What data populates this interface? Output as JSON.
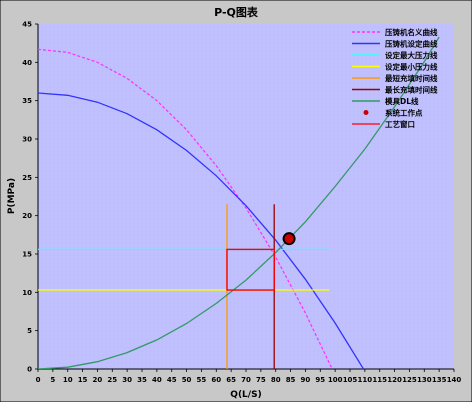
{
  "chart_data": {
    "type": "line",
    "title": "P-Q图表",
    "xlabel": "Q(L/S)",
    "ylabel": "P(MPa)",
    "xlim": [
      0,
      140
    ],
    "ylim": [
      0,
      45
    ],
    "xticks": [
      0,
      5,
      10,
      15,
      20,
      25,
      30,
      35,
      40,
      45,
      50,
      55,
      60,
      65,
      70,
      75,
      80,
      85,
      90,
      95,
      100,
      105,
      110,
      115,
      120,
      125,
      130,
      135,
      140
    ],
    "yticks": [
      0,
      5,
      10,
      15,
      20,
      25,
      30,
      35,
      40,
      45
    ],
    "grid": false,
    "legend_position": "top-right",
    "colors": {
      "outer_background": "#c8c8c8",
      "plot_background": "#c0c0ff",
      "compressor_nominal": "#ff33ff",
      "compressor_setting": "#3333ff",
      "set_max_pressure": "#33ffff",
      "set_min_pressure": "#ffff00",
      "shortest_fill_time": "#ff9900",
      "longest_fill_time": "#990000",
      "pump_dl": "#339966",
      "work_point": "#cc0000",
      "process_window": "#ff0000"
    },
    "series": [
      {
        "name": "压铸机名义曲线",
        "style": "dashed",
        "x": [
          0,
          10,
          20,
          30,
          40,
          50,
          60,
          70,
          80,
          90,
          100,
          104
        ],
        "y": [
          41.7,
          41.3,
          40.0,
          37.9,
          35.0,
          31.2,
          26.5,
          21.0,
          14.6,
          7.3,
          -0.8,
          -4.2
        ]
      },
      {
        "name": "压铸机设定曲线",
        "style": "solid",
        "x": [
          0,
          10,
          20,
          30,
          40,
          50,
          60,
          70,
          80,
          90,
          100,
          110,
          114
        ],
        "y": [
          36.0,
          35.7,
          34.8,
          33.3,
          31.2,
          28.5,
          25.2,
          21.3,
          16.8,
          11.7,
          6.0,
          -0.3,
          -2.8
        ]
      },
      {
        "name": "设定最大压力线",
        "style": "solid",
        "x": [
          0,
          98
        ],
        "y": [
          15.6,
          15.6
        ]
      },
      {
        "name": "设定最小压力线",
        "style": "solid",
        "x": [
          0,
          98
        ],
        "y": [
          10.3,
          10.3
        ]
      },
      {
        "name": "最短充填时间线",
        "style": "solid",
        "x": [
          63.6,
          63.6
        ],
        "y": [
          0,
          21.5
        ]
      },
      {
        "name": "最长充填时间线",
        "style": "solid",
        "x": [
          79.5,
          79.5
        ],
        "y": [
          0,
          21.5
        ]
      },
      {
        "name": "模具DL线",
        "style": "solid",
        "x": [
          0,
          10,
          20,
          30,
          40,
          50,
          60,
          70,
          80,
          90,
          100,
          110,
          120,
          130,
          135
        ],
        "y": [
          0,
          0.24,
          0.95,
          2.14,
          3.8,
          5.94,
          8.55,
          11.6,
          15.2,
          19.2,
          23.8,
          28.7,
          34.2,
          40.1,
          43.3
        ]
      }
    ],
    "work_point": {
      "name": "系统工作点",
      "x": 84.5,
      "y": 17.0
    },
    "process_window": {
      "name": "工艺窗口",
      "x": [
        63.6,
        79.5
      ],
      "y": [
        10.3,
        15.6
      ]
    },
    "legend": [
      {
        "label": "压铸机名义曲线",
        "kind": "dashed-line",
        "color_key": "compressor_nominal"
      },
      {
        "label": "压铸机设定曲线",
        "kind": "line",
        "color_key": "compressor_setting"
      },
      {
        "label": "设定最大压力线",
        "kind": "line",
        "color_key": "set_max_pressure"
      },
      {
        "label": "设定最小压力线",
        "kind": "line",
        "color_key": "set_min_pressure"
      },
      {
        "label": "最短充填时间线",
        "kind": "line",
        "color_key": "shortest_fill_time"
      },
      {
        "label": "最长充填时间线",
        "kind": "line",
        "color_key": "longest_fill_time"
      },
      {
        "label": "模具DL线",
        "kind": "line",
        "color_key": "pump_dl"
      },
      {
        "label": "系统工作点",
        "kind": "marker",
        "color_key": "work_point"
      },
      {
        "label": "工艺窗口",
        "kind": "box",
        "color_key": "process_window"
      }
    ]
  }
}
